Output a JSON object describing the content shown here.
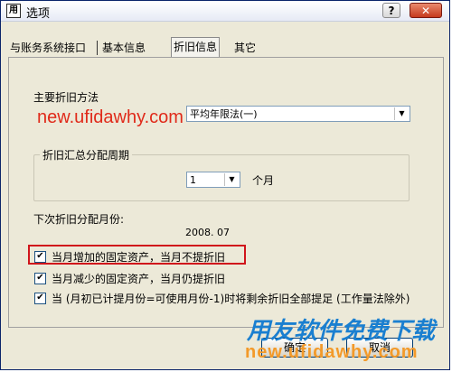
{
  "window": {
    "title": "选项",
    "app_icon": "app-icon",
    "help_label": "?",
    "close_label": "✕"
  },
  "tabs": [
    {
      "label": "与账务系统接口",
      "active": false
    },
    {
      "label": "基本信息",
      "active": false
    },
    {
      "label": "折旧信息",
      "active": true
    },
    {
      "label": "其它",
      "active": false
    }
  ],
  "depreciation": {
    "method_label": "主要折旧方法",
    "method_value": "平均年限法(一)",
    "period_group_label": "折旧汇总分配周期",
    "period_value": "1",
    "period_unit": "个月",
    "next_month_label": "下次折旧分配月份:",
    "next_month_value": "2008. 07"
  },
  "checkboxes": [
    {
      "label": "当月增加的固定资产，当月不提折旧",
      "checked": true,
      "highlighted": true
    },
    {
      "label": "当月减少的固定资产，当月仍提折旧",
      "checked": true,
      "highlighted": false
    },
    {
      "label": "当 (月初已计提月份=可使用月份-1)时将剩余折旧全部提足 (工作量法除外)",
      "checked": true,
      "highlighted": false
    }
  ],
  "buttons": {
    "ok": "确定",
    "cancel": "取消"
  },
  "watermarks": {
    "url_top": "new.ufidawhy.com",
    "brand": "用友软件免费下载",
    "url_bottom": "new.ufidawhy.com"
  },
  "colors": {
    "highlight_border": "#d0151b",
    "watermark_red": "#e02a1a",
    "watermark_blue": "#1a7fd0",
    "watermark_orange": "#f39a2a"
  }
}
